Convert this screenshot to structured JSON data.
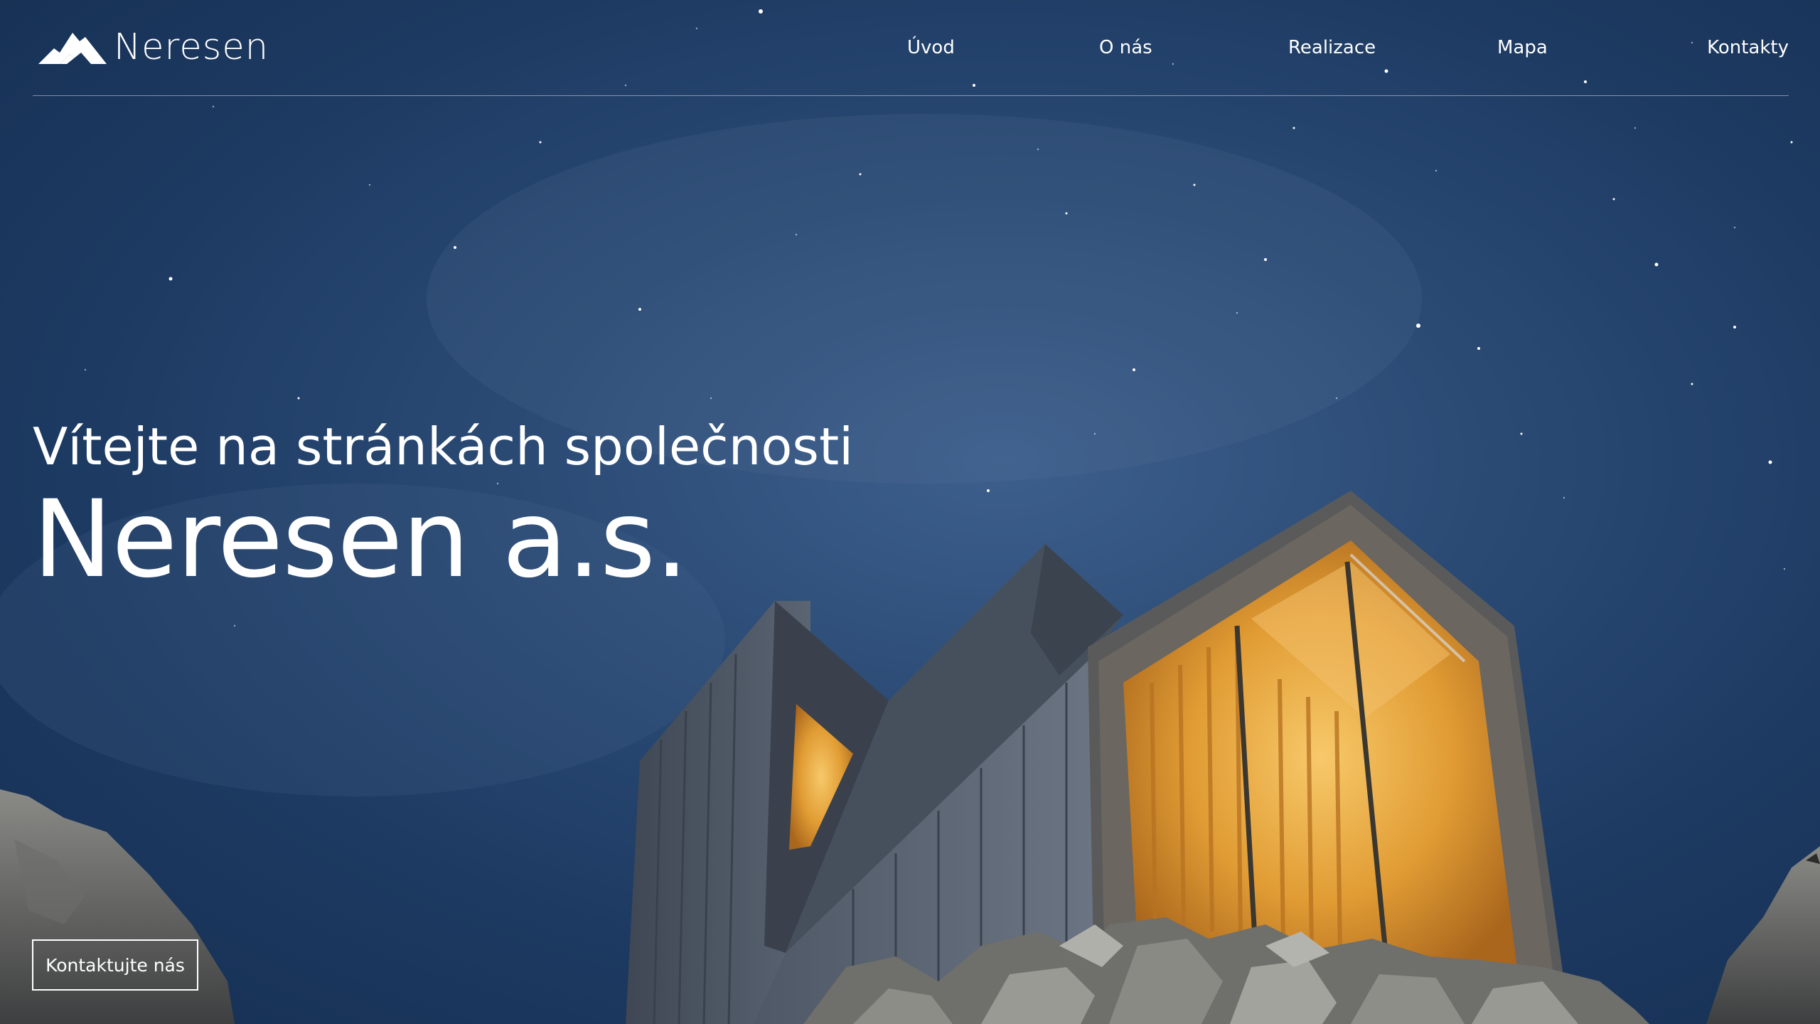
{
  "brand": {
    "name": "Neresen",
    "logo_icon": "mountain-icon"
  },
  "nav": {
    "items": [
      {
        "label": "Úvod"
      },
      {
        "label": "O nás"
      },
      {
        "label": "Realizace"
      },
      {
        "label": "Mapa"
      },
      {
        "label": "Kontakty"
      }
    ]
  },
  "hero": {
    "subtitle": "Vítejte na stránkách společnosti",
    "title": "Neresen a.s.",
    "cta_label": "Kontaktujte nás"
  },
  "colors": {
    "sky_dark": "#162f52",
    "sky_mid": "#2a4a74",
    "cabin_glow": "#e9a53a",
    "cabin_wall": "#4a5666",
    "text": "#ffffff"
  }
}
